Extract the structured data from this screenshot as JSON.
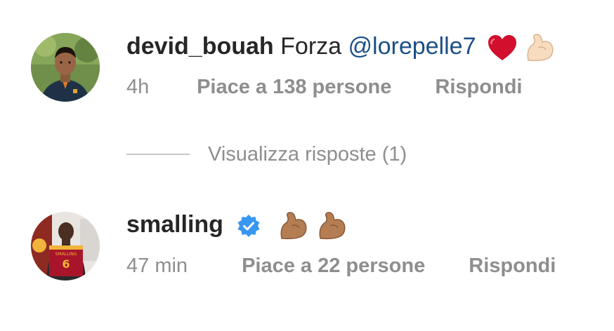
{
  "comments": [
    {
      "username": "devid_bouah",
      "text": "Forza",
      "mention": "@lorepelle7",
      "emojis": [
        "red-heart-icon",
        "flexed-biceps-light-icon"
      ],
      "time": "4h",
      "likes": "Piace a 138 persone",
      "reply_label": "Rispondi"
    },
    {
      "username": "smalling",
      "verified": true,
      "emojis": [
        "flexed-biceps-medium-icon",
        "flexed-biceps-medium-icon"
      ],
      "time": "47 min",
      "likes": "Piace a 22 persone",
      "reply_label": "Rispondi"
    }
  ],
  "view_replies": "Visualizza risposte (1)",
  "colors": {
    "primary_text": "#262626",
    "secondary_text": "#8e8e8e",
    "mention": "#1b4f86",
    "verified_badge": "#3897f0",
    "divider": "#c7c7c7"
  }
}
